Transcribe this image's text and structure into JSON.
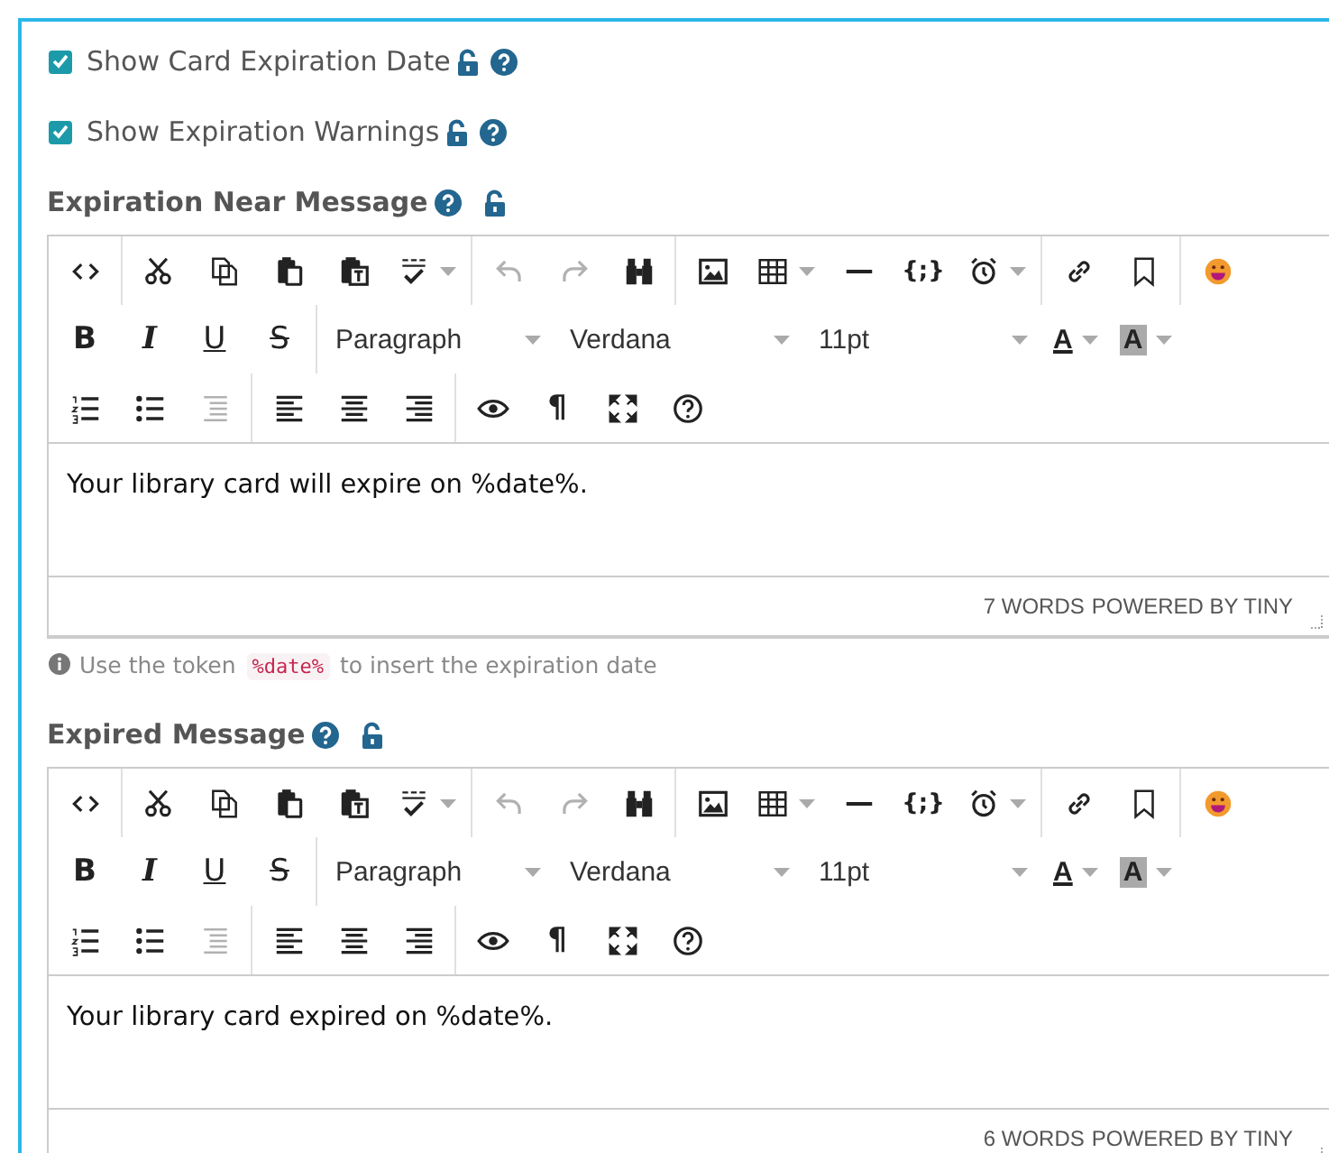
{
  "settings": [
    {
      "label": "Show Card Expiration Date",
      "checked": true
    },
    {
      "label": "Show Expiration Warnings",
      "checked": true
    }
  ],
  "editors": [
    {
      "title": "Expiration Near Message",
      "toolbar": [
        [
          [
            {
              "kind": "code",
              "disabled": false
            }
          ],
          [
            {
              "kind": "cut",
              "disabled": false
            },
            {
              "kind": "copy",
              "disabled": false
            },
            {
              "kind": "paste",
              "disabled": false
            },
            {
              "kind": "paste-text",
              "disabled": false
            },
            {
              "kind": "spellcheck",
              "disabled": false
            }
          ],
          [
            {
              "kind": "undo",
              "disabled": true
            },
            {
              "kind": "redo",
              "disabled": true
            },
            {
              "kind": "find",
              "disabled": false
            }
          ],
          [
            {
              "kind": "image",
              "disabled": false
            },
            {
              "kind": "table",
              "disabled": false
            },
            {
              "kind": "hr",
              "disabled": false
            },
            {
              "kind": "template",
              "label": "{;}",
              "disabled": false
            },
            {
              "kind": "alarm",
              "disabled": false
            }
          ],
          [
            {
              "kind": "link",
              "disabled": false
            },
            {
              "kind": "bookmark",
              "disabled": false
            }
          ],
          [
            {
              "kind": "emoji",
              "disabled": false
            }
          ]
        ],
        [
          [
            {
              "kind": "bold",
              "label": "B",
              "disabled": false
            },
            {
              "kind": "italic",
              "label": "I",
              "disabled": false
            },
            {
              "kind": "underline",
              "label": "U",
              "disabled": false
            },
            {
              "kind": "strike",
              "label": "S",
              "disabled": false
            }
          ],
          [
            {
              "kind": "select",
              "value": "Paragraph",
              "disabled": false
            },
            {
              "kind": "select",
              "value": "Verdana",
              "disabled": false
            },
            {
              "kind": "select",
              "value": "11pt",
              "disabled": false
            },
            {
              "kind": "text-color",
              "label": "A",
              "disabled": false
            },
            {
              "kind": "bg-color",
              "label": "A",
              "disabled": false
            }
          ]
        ],
        [
          [
            {
              "kind": "ol",
              "disabled": false
            },
            {
              "kind": "ul",
              "disabled": false
            },
            {
              "kind": "indent",
              "disabled": true
            }
          ],
          [
            {
              "kind": "align-left",
              "disabled": false
            },
            {
              "kind": "align-center",
              "disabled": false
            },
            {
              "kind": "align-right",
              "disabled": false
            }
          ],
          [
            {
              "kind": "preview",
              "disabled": false
            },
            {
              "kind": "pilcrow",
              "label": "¶",
              "disabled": false
            },
            {
              "kind": "fullscreen",
              "disabled": false
            },
            {
              "kind": "help",
              "disabled": false
            }
          ]
        ]
      ],
      "content": "Your library card will expire on %date%.",
      "word_count": "7 WORDS",
      "branding": "POWERED BY TINY",
      "hint": {
        "before": "Use the token",
        "token": "%date%",
        "after": "to insert the expiration date"
      }
    },
    {
      "title": "Expired Message",
      "toolbar": [
        [
          [
            {
              "kind": "code",
              "disabled": false
            }
          ],
          [
            {
              "kind": "cut",
              "disabled": false
            },
            {
              "kind": "copy",
              "disabled": false
            },
            {
              "kind": "paste",
              "disabled": false
            },
            {
              "kind": "paste-text",
              "disabled": false
            },
            {
              "kind": "spellcheck",
              "disabled": false
            }
          ],
          [
            {
              "kind": "undo",
              "disabled": true
            },
            {
              "kind": "redo",
              "disabled": true
            },
            {
              "kind": "find",
              "disabled": false
            }
          ],
          [
            {
              "kind": "image",
              "disabled": false
            },
            {
              "kind": "table",
              "disabled": false
            },
            {
              "kind": "hr",
              "disabled": false
            },
            {
              "kind": "template",
              "label": "{;}",
              "disabled": false
            },
            {
              "kind": "alarm",
              "disabled": false
            }
          ],
          [
            {
              "kind": "link",
              "disabled": false
            },
            {
              "kind": "bookmark",
              "disabled": false
            }
          ],
          [
            {
              "kind": "emoji",
              "disabled": false
            }
          ]
        ],
        [
          [
            {
              "kind": "bold",
              "label": "B",
              "disabled": false
            },
            {
              "kind": "italic",
              "label": "I",
              "disabled": false
            },
            {
              "kind": "underline",
              "label": "U",
              "disabled": false
            },
            {
              "kind": "strike",
              "label": "S",
              "disabled": false
            }
          ],
          [
            {
              "kind": "select",
              "value": "Paragraph",
              "disabled": false
            },
            {
              "kind": "select",
              "value": "Verdana",
              "disabled": false
            },
            {
              "kind": "select",
              "value": "11pt",
              "disabled": false
            },
            {
              "kind": "text-color",
              "label": "A",
              "disabled": false
            },
            {
              "kind": "bg-color",
              "label": "A",
              "disabled": false
            }
          ]
        ],
        [
          [
            {
              "kind": "ol",
              "disabled": false
            },
            {
              "kind": "ul",
              "disabled": false
            },
            {
              "kind": "indent",
              "disabled": true
            }
          ],
          [
            {
              "kind": "align-left",
              "disabled": false
            },
            {
              "kind": "align-center",
              "disabled": false
            },
            {
              "kind": "align-right",
              "disabled": false
            }
          ],
          [
            {
              "kind": "preview",
              "disabled": false
            },
            {
              "kind": "pilcrow",
              "label": "¶",
              "disabled": false
            },
            {
              "kind": "fullscreen",
              "disabled": false
            },
            {
              "kind": "help",
              "disabled": false
            }
          ]
        ]
      ],
      "content": "Your library card expired on %date%.",
      "word_count": "6 WORDS",
      "branding": "POWERED BY TINY"
    }
  ]
}
